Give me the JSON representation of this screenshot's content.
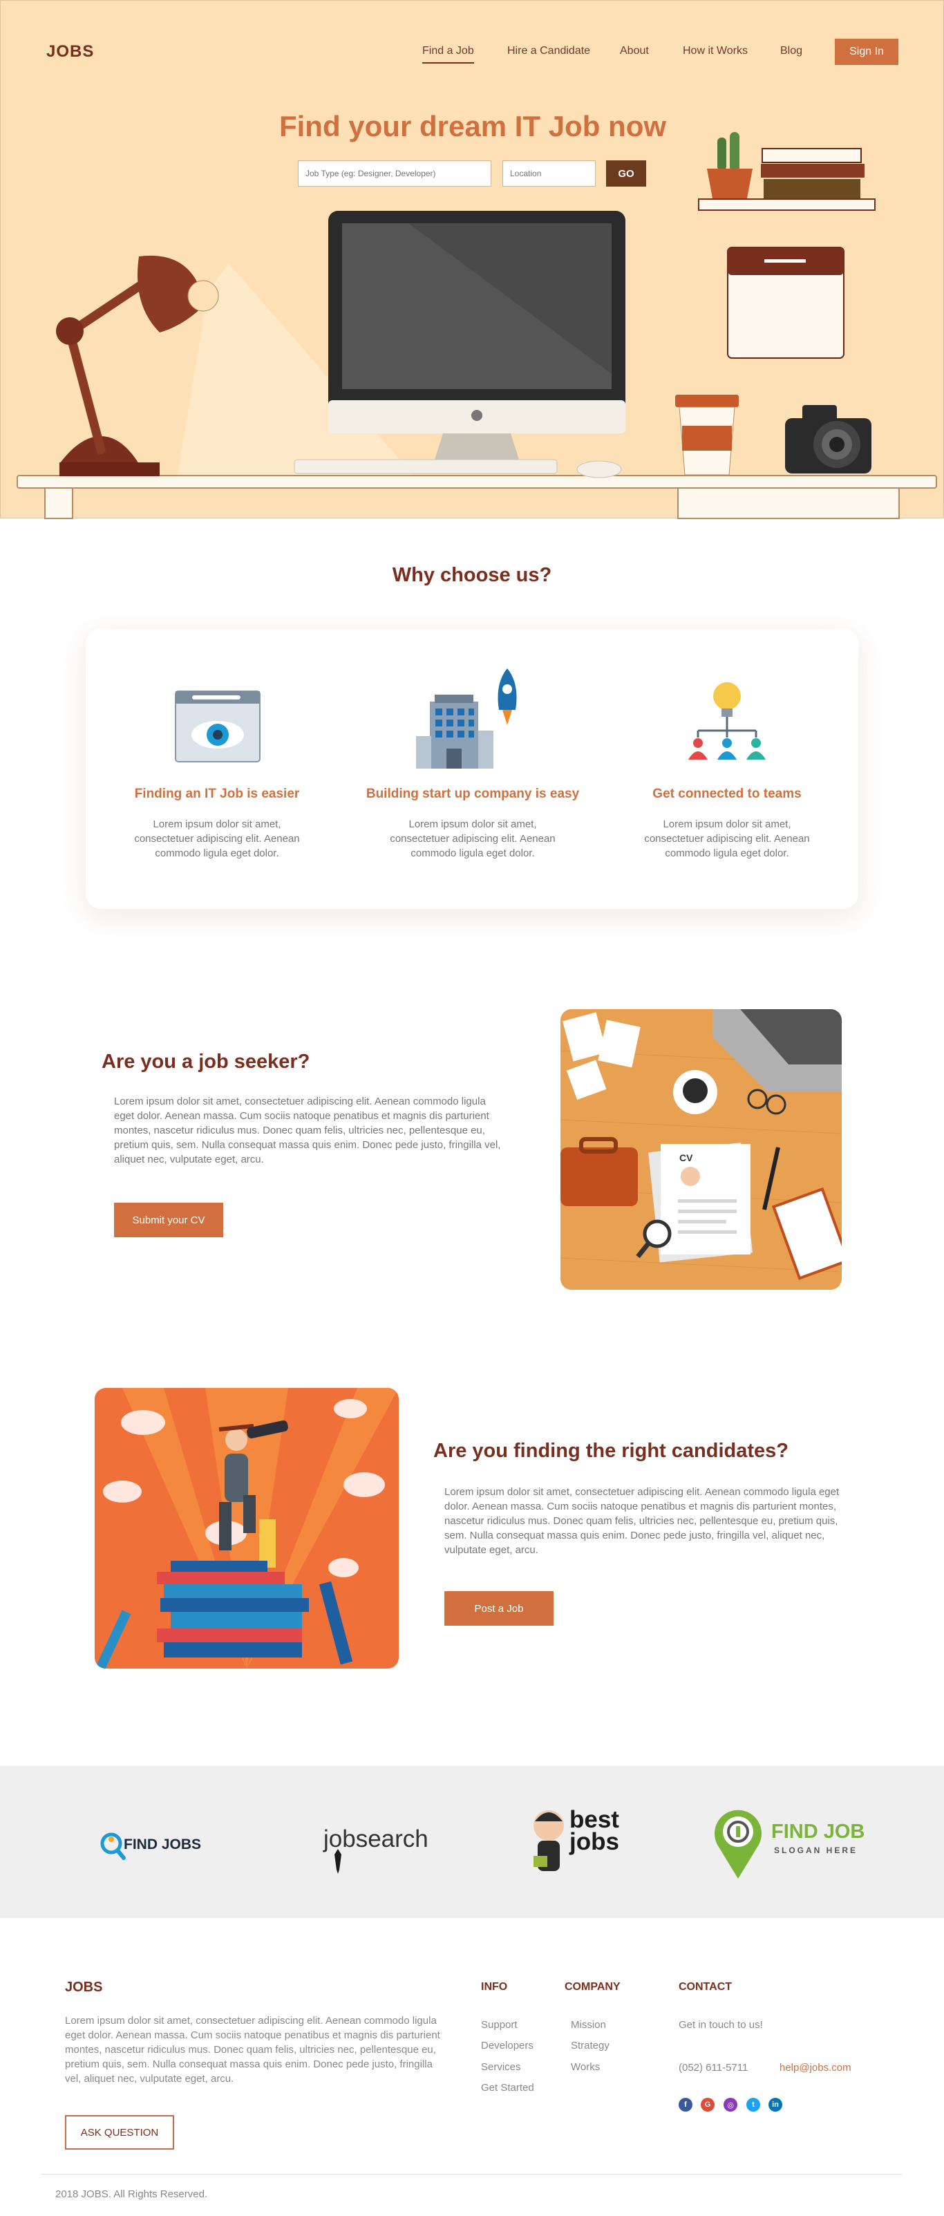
{
  "header": {
    "logo": "JOBS",
    "nav": [
      "Find a Job",
      "Hire a Candidate",
      "About",
      "How it Works",
      "Blog"
    ],
    "signin": "Sign In"
  },
  "hero": {
    "title": "Find your dream IT Job now",
    "job_placeholder": "Job Type (eg: Designer, Developer)",
    "location_placeholder": "Location",
    "go": "GO"
  },
  "why": {
    "title": "Why choose us?",
    "features": [
      {
        "title": "Finding an IT Job is easier",
        "desc": "Lorem ipsum dolor sit amet, consectetuer adipiscing elit. Aenean commodo ligula eget dolor."
      },
      {
        "title": "Building start up company is easy",
        "desc": "Lorem ipsum dolor sit amet, consectetuer adipiscing elit. Aenean commodo ligula eget dolor."
      },
      {
        "title": "Get connected to teams",
        "desc": "Lorem ipsum dolor sit amet, consectetuer adipiscing elit. Aenean commodo ligula eget dolor."
      }
    ]
  },
  "seeker": {
    "title": "Are you a job seeker?",
    "text": "Lorem ipsum dolor sit amet, consectetuer adipiscing elit. Aenean commodo ligula eget dolor. Aenean massa. Cum sociis natoque penatibus et magnis dis parturient montes, nascetur ridiculus mus. Donec quam felis, ultricies nec, pellentesque eu, pretium quis, sem. Nulla consequat massa quis enim. Donec pede justo, fringilla vel, aliquet nec, vulputate eget, arcu.",
    "button": "Submit your CV",
    "cv_label": "CV"
  },
  "candidates": {
    "title": "Are you finding the right candidates?",
    "text": "Lorem ipsum dolor sit amet, consectetuer adipiscing elit. Aenean commodo ligula eget dolor. Aenean massa. Cum sociis natoque penatibus et magnis dis parturient montes, nascetur ridiculus mus. Donec quam felis, ultricies nec, pellentesque eu, pretium quis, sem. Nulla consequat massa quis enim. Donec pede justo, fringilla vel, aliquet nec, vulputate eget, arcu.",
    "button": "Post a Job"
  },
  "partners": [
    {
      "name": "FIND JOBS",
      "icon": "magnifier-person-icon"
    },
    {
      "name": "jobsearch",
      "icon": "tie-icon"
    },
    {
      "name": "best jobs",
      "icon": "man-with-briefcase-icon"
    },
    {
      "name": "FIND JOB",
      "tagline": "SLOGAN HERE",
      "icon": "map-pin-icon"
    }
  ],
  "footer": {
    "logo": "JOBS",
    "about": "Lorem ipsum dolor sit amet, consectetuer adipiscing elit. Aenean commodo ligula eget dolor. Aenean massa. Cum sociis natoque penatibus et magnis dis parturient montes, nascetur ridiculus mus. Donec quam felis, ultricies nec, pellentesque eu, pretium quis, sem. Nulla consequat massa quis enim. Donec pede justo, fringilla vel, aliquet nec, vulputate eget, arcu.",
    "ask": "ASK QUESTION",
    "info_title": "INFO",
    "info_links": [
      "Support",
      "Developers",
      "Services",
      "Get Started"
    ],
    "company_title": "COMPANY",
    "company_links": [
      "Mission",
      "Strategy",
      "Works"
    ],
    "contact_title": "CONTACT",
    "contact_text": "Get in touch to us!",
    "phone": "(052) 611-5711",
    "email": "help@jobs.com",
    "social": [
      {
        "icon": "facebook-icon",
        "glyph": "f",
        "color": "#3b5998"
      },
      {
        "icon": "google-plus-icon",
        "glyph": "G",
        "color": "#dd4b39"
      },
      {
        "icon": "instagram-icon",
        "glyph": "◎",
        "color": "#8a3ab9"
      },
      {
        "icon": "twitter-icon",
        "glyph": "t",
        "color": "#1da1f2"
      },
      {
        "icon": "linkedin-icon",
        "glyph": "in",
        "color": "#0077b5"
      }
    ],
    "copyright": "2018 JOBS. All Rights Reserved."
  }
}
